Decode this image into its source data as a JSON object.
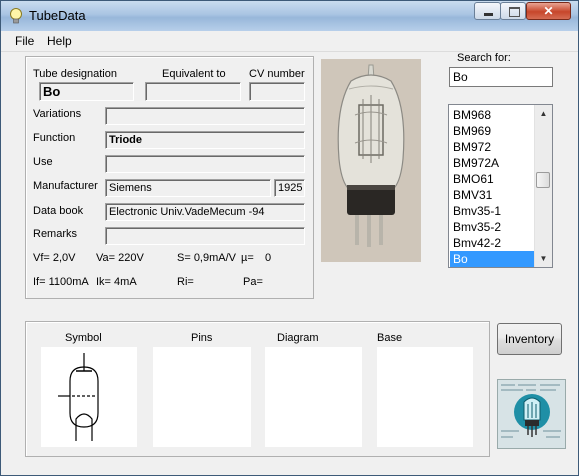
{
  "window": {
    "title": "TubeData"
  },
  "menu": {
    "file": "File",
    "help": "Help"
  },
  "labels": {
    "tube_designation": "Tube designation",
    "equivalent_to": "Equivalent to",
    "cv_number": "CV number",
    "variations": "Variations",
    "function": "Function",
    "use": "Use",
    "manufacturer": "Manufacturer",
    "data_book": "Data book",
    "remarks": "Remarks",
    "search_for": "Search for:"
  },
  "fields": {
    "tube_designation": "Bo",
    "equivalent_to": "",
    "cv_number": "",
    "variations": "",
    "function": "Triode",
    "use": "",
    "manufacturer": "Siemens",
    "year": "1925",
    "data_book": "Electronic Univ.VadeMecum -94",
    "remarks": ""
  },
  "params": {
    "vf": "Vf= 2,0V",
    "va": "Va=  220V",
    "s": "S= 0,9mA/V",
    "mu": "µ=",
    "mu_value": "0",
    "if": "If= 1100mA",
    "ik": "Ik=   4mA",
    "ri": "Ri=",
    "pa": "Pa="
  },
  "search": {
    "value": "Bo"
  },
  "tube_list": {
    "items": [
      "BM968",
      "BM969",
      "BM972",
      "BM972A",
      "BMO61",
      "BMV31",
      "Bmv35-1",
      "Bmv35-2",
      "Bmv42-2",
      "Bo"
    ],
    "selected": "Bo"
  },
  "bottom": {
    "symbol": "Symbol",
    "pins": "Pins",
    "diagram": "Diagram",
    "base": "Base"
  },
  "buttons": {
    "inventory": "Inventory"
  }
}
